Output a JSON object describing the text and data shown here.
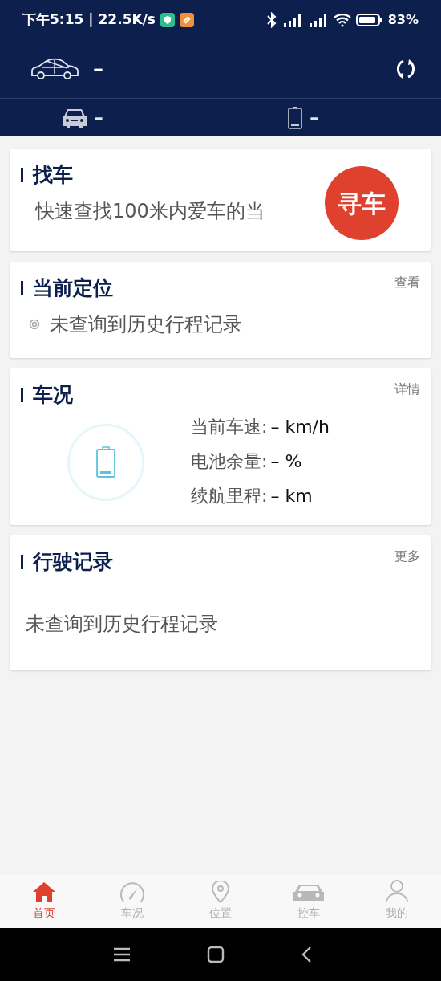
{
  "status_bar": {
    "time": "下午5:15",
    "separator": "|",
    "speed": "22.5K/s",
    "battery": "83%"
  },
  "header": {
    "vehicle_name": "–"
  },
  "summary": [
    {
      "kind": "car",
      "value": "–"
    },
    {
      "kind": "battery",
      "value": "–"
    }
  ],
  "find_car": {
    "title": "找车",
    "description": "快速查找100米内爱车的当",
    "button": "寻车"
  },
  "location": {
    "title": "当前定位",
    "link": "查看",
    "message": "未查询到历史行程记录"
  },
  "condition": {
    "title": "车况",
    "link": "详情",
    "rows": [
      {
        "label": "当前车速:",
        "value": "– km/h"
      },
      {
        "label": "电池余量:",
        "value": "– %"
      },
      {
        "label": "续航里程:",
        "value": "– km"
      }
    ]
  },
  "trips": {
    "title": "行驶记录",
    "link": "更多",
    "message": "未查询到历史行程记录"
  },
  "bottom_nav": [
    {
      "kind": "home",
      "label": "首页",
      "selected": true
    },
    {
      "kind": "gauge",
      "label": "车况",
      "selected": false
    },
    {
      "kind": "pin",
      "label": "位置",
      "selected": false
    },
    {
      "kind": "car",
      "label": "控车",
      "selected": false
    },
    {
      "kind": "user",
      "label": "我的",
      "selected": false
    }
  ]
}
